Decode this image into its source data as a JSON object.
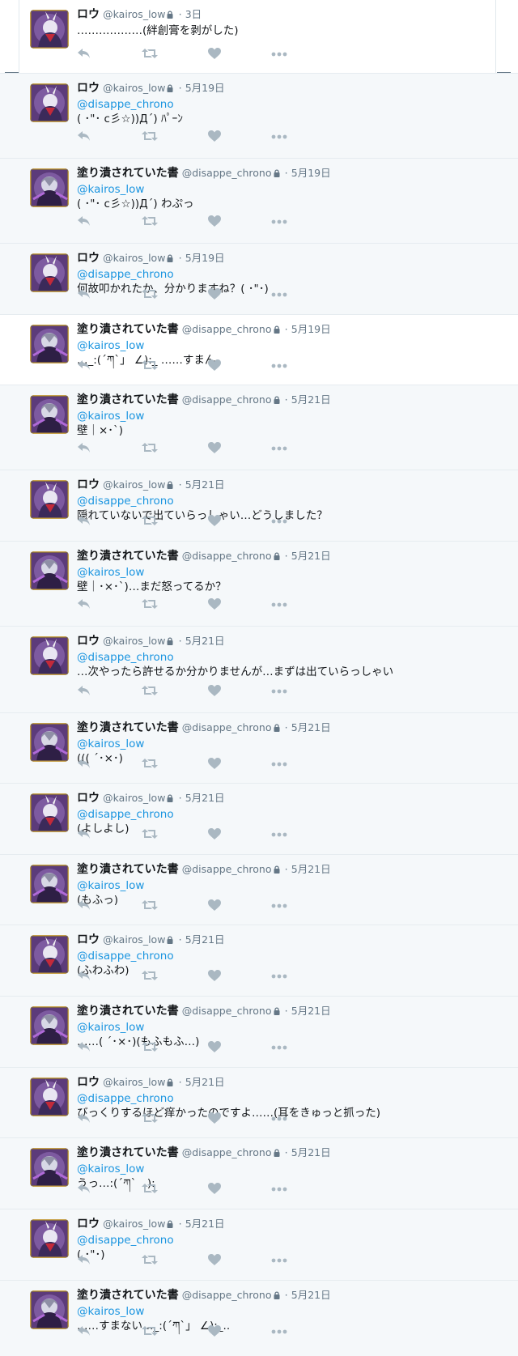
{
  "colors": {
    "mention": "#1b95e0",
    "name": "#14171a",
    "meta": "#657786",
    "icon": "#aab8c2",
    "background": "#f5f8fa",
    "separator": "#e6ecf0"
  },
  "icons": {
    "reply": "reply-icon",
    "retweet": "retweet-icon",
    "like": "heart-icon",
    "more": "more-icon",
    "lock": "lock-icon"
  },
  "tweets": [
    {
      "name": "ロウ",
      "handle": "@kairos_low",
      "sep": "·",
      "time": "3日",
      "mention": "",
      "text": "………………(絆創膏を剥がした)"
    },
    {
      "name": "ロウ",
      "handle": "@kairos_low",
      "sep": "·",
      "time": "5月19日",
      "mention": "@disappe_chrono",
      "text": "( ･\"･ c彡☆))Д´) ﾊﾟｰﾝ"
    },
    {
      "name": "塗り潰されていた書",
      "handle": "@disappe_chrono",
      "sep": "·",
      "time": "5月19日",
      "mention": "@kairos_low",
      "text": "( ･\"･ c彡☆))Д´) わぷっ"
    },
    {
      "name": "ロウ",
      "handle": "@kairos_low",
      "sep": "·",
      "time": "5月19日",
      "mention": "@disappe_chrono",
      "text": "何故叩かれたか、分かりますね？( ･\"･)"
    },
    {
      "name": "塗り潰されていた書",
      "handle": "@disappe_chrono",
      "sep": "·",
      "time": "5月19日",
      "mention": "@kairos_low",
      "text": "…_:(´ཀ`」 ∠):_ ……すまん"
    },
    {
      "name": "塗り潰されていた書",
      "handle": "@disappe_chrono",
      "sep": "·",
      "time": "5月21日",
      "mention": "@kairos_low",
      "text": "壁｜×･`)"
    },
    {
      "name": "ロウ",
      "handle": "@kairos_low",
      "sep": "·",
      "time": "5月21日",
      "mention": "@disappe_chrono",
      "text": "隠れていないで出ていらっしゃい…どうしました？"
    },
    {
      "name": "塗り潰されていた書",
      "handle": "@disappe_chrono",
      "sep": "·",
      "time": "5月21日",
      "mention": "@kairos_low",
      "text": "壁｜･×･`)…まだ怒ってるか？"
    },
    {
      "name": "ロウ",
      "handle": "@kairos_low",
      "sep": "·",
      "time": "5月21日",
      "mention": "@disappe_chrono",
      "text": "…次やったら許せるか分かりませんが…まずは出ていらっしゃい"
    },
    {
      "name": "塗り潰されていた書",
      "handle": "@disappe_chrono",
      "sep": "·",
      "time": "5月21日",
      "mention": "@kairos_low",
      "text": "((( ´･×･)"
    },
    {
      "name": "ロウ",
      "handle": "@kairos_low",
      "sep": "·",
      "time": "5月21日",
      "mention": "@disappe_chrono",
      "text": "(よしよし)"
    },
    {
      "name": "塗り潰されていた書",
      "handle": "@disappe_chrono",
      "sep": "·",
      "time": "5月21日",
      "mention": "@kairos_low",
      "text": "(もふっ)"
    },
    {
      "name": "ロウ",
      "handle": "@kairos_low",
      "sep": "·",
      "time": "5月21日",
      "mention": "@disappe_chrono",
      "text": "(ふわふわ)"
    },
    {
      "name": "塗り潰されていた書",
      "handle": "@disappe_chrono",
      "sep": "·",
      "time": "5月21日",
      "mention": "@kairos_low",
      "text": "……( ´･×･)(もふもふ…)"
    },
    {
      "name": "ロウ",
      "handle": "@kairos_low",
      "sep": "·",
      "time": "5月21日",
      "mention": "@disappe_chrono",
      "text": "びっくりするほど痒かったのですよ……(耳をきゅっと抓った)"
    },
    {
      "name": "塗り潰されていた書",
      "handle": "@disappe_chrono",
      "sep": "·",
      "time": "5月21日",
      "mention": "@kairos_low",
      "text": "うっ…:(´ཀ`　):"
    },
    {
      "name": "ロウ",
      "handle": "@kairos_low",
      "sep": "·",
      "time": "5月21日",
      "mention": "@disappe_chrono",
      "text": "( ･\"･)"
    },
    {
      "name": "塗り潰されていた書",
      "handle": "@disappe_chrono",
      "sep": "·",
      "time": "5月21日",
      "mention": "@kairos_low",
      "text": "……すまない…_:(´ཀ`」 ∠):_.."
    }
  ]
}
